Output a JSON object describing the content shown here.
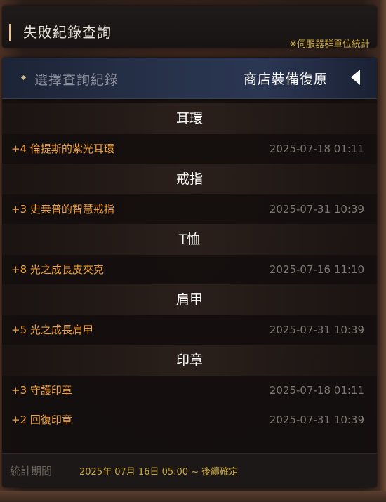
{
  "header": {
    "title": "失敗紀錄查詢",
    "note": "※伺服器群單位統計"
  },
  "selector": {
    "label": "選擇查詢紀錄",
    "value": "商店裝備復原"
  },
  "categories": [
    {
      "name": "耳環",
      "items": [
        {
          "name": "+4 倫提斯的紫光耳環",
          "date": "2025-07-18 01:11"
        }
      ]
    },
    {
      "name": "戒指",
      "items": [
        {
          "name": "+3 史桒普的智慧戒指",
          "date": "2025-07-31 10:39"
        }
      ]
    },
    {
      "name": "T恤",
      "items": [
        {
          "name": "+8 光之成長皮夾克",
          "date": "2025-07-16 11:10"
        }
      ]
    },
    {
      "name": "肩甲",
      "items": [
        {
          "name": "+5 光之成長肩甲",
          "date": "2025-07-31 10:39"
        }
      ]
    },
    {
      "name": "印章",
      "items": [
        {
          "name": "+3 守護印章",
          "date": "2025-07-18 01:11"
        },
        {
          "name": "+2 回復印章",
          "date": "2025-07-31 10:39"
        }
      ]
    }
  ],
  "footer": {
    "label": "統計期間",
    "value": "2025年 07月 16日 05:00 ~ 後續確定"
  },
  "colors": {
    "item_name": "#f0a23c",
    "note": "#c8a640",
    "date": "#7f7872",
    "selector_bg": "#27324b"
  },
  "icons": {
    "selector_arrow": "triangle-left-icon",
    "selector_bullet": "diamond-bullet-icon",
    "title_bar": "accent-bar"
  }
}
